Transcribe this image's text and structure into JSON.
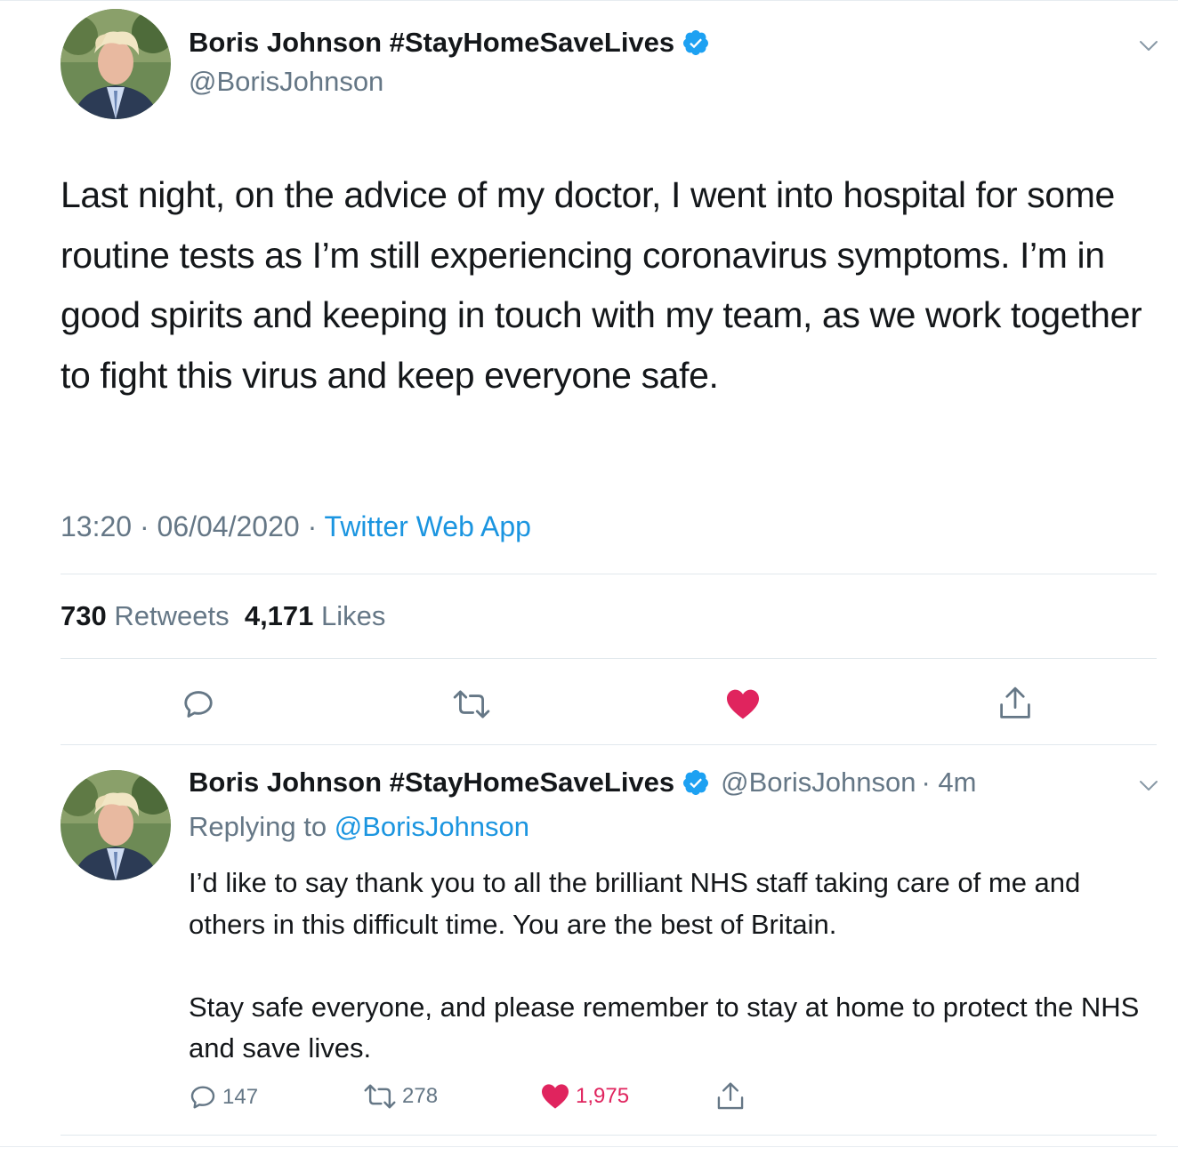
{
  "main_tweet": {
    "display_name": "Boris Johnson #StayHomeSaveLives",
    "handle": "@BorisJohnson",
    "text": "Last night, on the advice of my doctor, I went into hospital for some routine tests as I’m still experiencing coronavirus symptoms. I’m in good spirits and keeping in touch with my team, as we work together to fight this virus and keep everyone safe.",
    "time": "13:20",
    "separator": " · ",
    "date": "06/04/2020",
    "source": "Twitter Web App",
    "retweet_count": "730",
    "retweet_label": "Retweets",
    "like_count": "4,171",
    "like_label": "Likes",
    "actions": {
      "reply_icon": "reply-icon",
      "retweet_icon": "retweet-icon",
      "like_icon": "heart-icon",
      "share_icon": "share-icon"
    }
  },
  "reply_tweet": {
    "display_name": "Boris Johnson #StayHomeSaveLives",
    "handle": "@BorisJohnson",
    "time_ago": "· 4m",
    "replying_to_label": "Replying to",
    "replying_to_handle": "@BorisJohnson",
    "text": "I’d like to say thank you to all the brilliant NHS staff taking care of me and others in this difficult time. You are the best of Britain.\n\nStay safe everyone, and please remember to stay at home to protect the NHS and save lives.",
    "reply_count": "147",
    "retweet_count": "278",
    "like_count": "1,975"
  },
  "colors": {
    "text": "#14171a",
    "secondary": "#657786",
    "link": "#1b95e0",
    "verified": "#1da1f2",
    "like": "#e0245e",
    "divider": "#e1e8ed"
  }
}
